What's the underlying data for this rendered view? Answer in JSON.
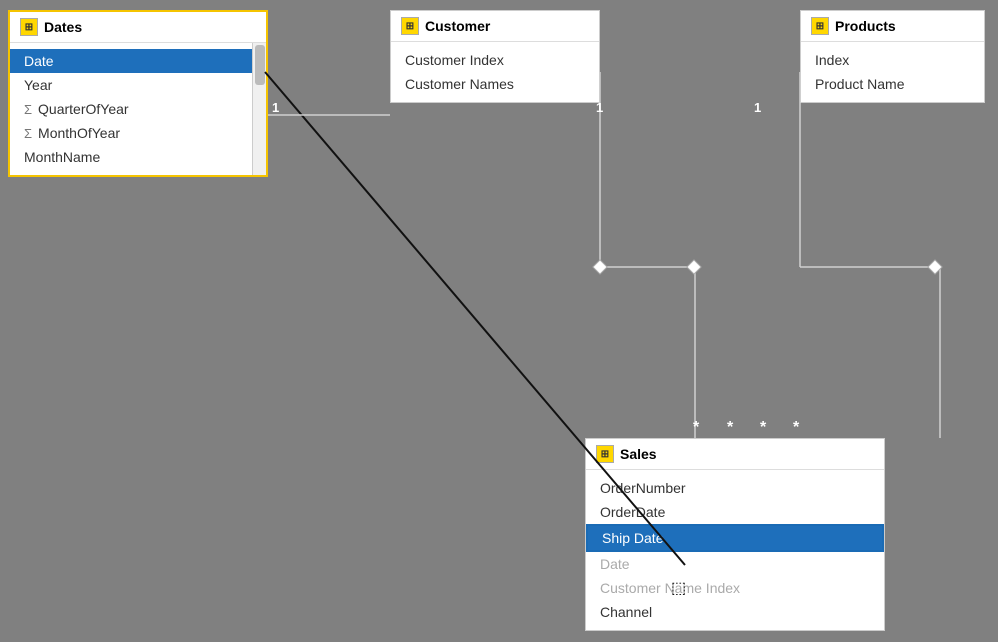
{
  "tables": {
    "dates": {
      "title": "Dates",
      "fields": [
        {
          "name": "Date",
          "type": "plain",
          "selected": true
        },
        {
          "name": "Year",
          "type": "plain"
        },
        {
          "name": "QuarterOfYear",
          "type": "sigma"
        },
        {
          "name": "MonthOfYear",
          "type": "sigma"
        },
        {
          "name": "MonthName",
          "type": "plain"
        }
      ]
    },
    "customer": {
      "title": "Customer",
      "fields": [
        {
          "name": "Customer Index",
          "type": "plain"
        },
        {
          "name": "Customer Names",
          "type": "plain"
        }
      ]
    },
    "products": {
      "title": "Products",
      "fields": [
        {
          "name": "Index",
          "type": "plain"
        },
        {
          "name": "Product Name",
          "type": "plain"
        }
      ]
    },
    "sales": {
      "title": "Sales",
      "fields": [
        {
          "name": "OrderNumber",
          "type": "plain"
        },
        {
          "name": "OrderDate",
          "type": "plain"
        },
        {
          "name": "Ship Date",
          "type": "plain",
          "selected": true
        },
        {
          "name": "Date",
          "type": "plain",
          "faded": true
        },
        {
          "name": "Customer Name Index",
          "type": "plain",
          "faded": true
        },
        {
          "name": "Channel",
          "type": "plain"
        }
      ]
    }
  },
  "relations": {
    "one_labels": [
      "1",
      "1",
      "1"
    ],
    "star_labels": [
      "*",
      "*",
      "*",
      "*"
    ]
  }
}
